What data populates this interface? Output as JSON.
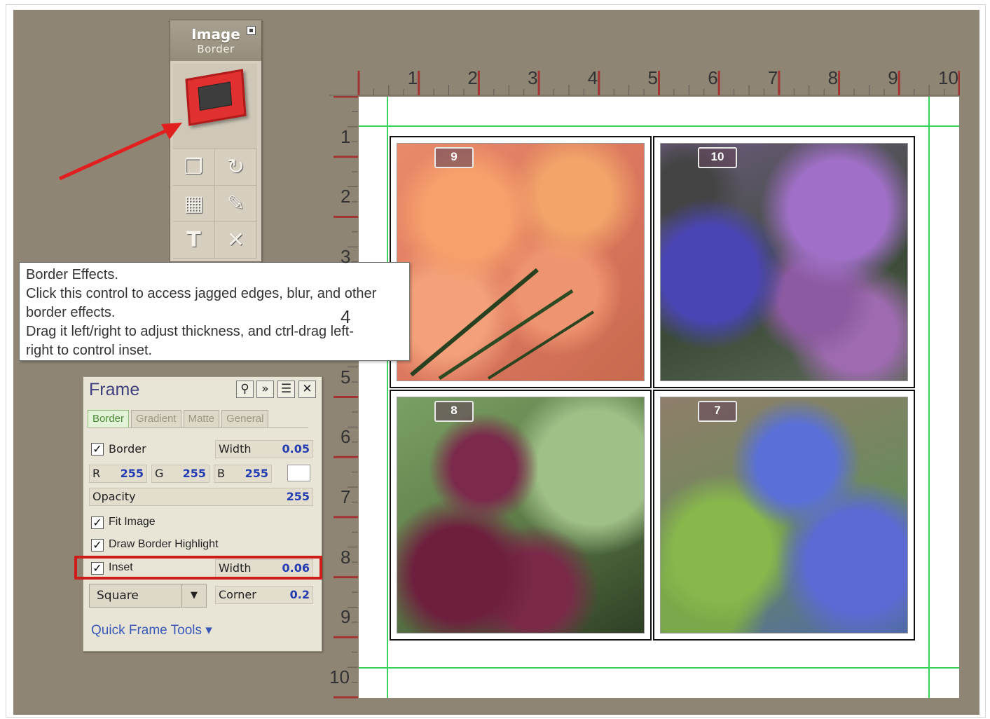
{
  "image_palette": {
    "title": "Image",
    "subtitle": "Border",
    "tool_icons": [
      "layers-icon",
      "rotate-icon",
      "grid-icon",
      "wrench-icon",
      "text-icon",
      "delete-icon"
    ]
  },
  "tooltip": {
    "lines": [
      "Border Effects.",
      "Click this control to access jagged edges, blur, and other",
      "border effects.",
      "Drag it left/right to adjust thickness, and ctrl-drag left-",
      "right to control inset."
    ]
  },
  "frame_panel": {
    "title": "Frame",
    "tabs": [
      "Border",
      "Gradient",
      "Matte",
      "General"
    ],
    "active_tab": "Border",
    "border_label": "Border",
    "width_label": "Width",
    "border_width": "0.05",
    "r_label": "R",
    "r_value": "255",
    "g_label": "G",
    "g_value": "255",
    "b_label": "B",
    "b_value": "255",
    "opacity_label": "Opacity",
    "opacity_value": "255",
    "fit_image_label": "Fit Image",
    "draw_border_highlight_label": "Draw Border Highlight",
    "inset_label": "Inset",
    "inset_width_label": "Width",
    "inset_width_value": "0.06",
    "shape_value": "Square",
    "corner_label": "Corner",
    "corner_value": "0.2",
    "quick_tools_label": "Quick Frame Tools ▾",
    "checked": "✓"
  },
  "ruler": {
    "top_labels": [
      "1",
      "2",
      "3",
      "4",
      "5",
      "6",
      "7",
      "8",
      "9",
      "10"
    ],
    "left_labels": [
      "1",
      "2",
      "3",
      "4",
      "5",
      "6",
      "7",
      "8",
      "9",
      "10"
    ]
  },
  "photos": [
    {
      "badge": "9"
    },
    {
      "badge": "10"
    },
    {
      "badge": "8"
    },
    {
      "badge": "7"
    }
  ],
  "colors": {
    "workspace": "#8e8574",
    "guide": "#37d25a",
    "highlight": "#d11b1b",
    "value_blue": "#233cb1"
  }
}
